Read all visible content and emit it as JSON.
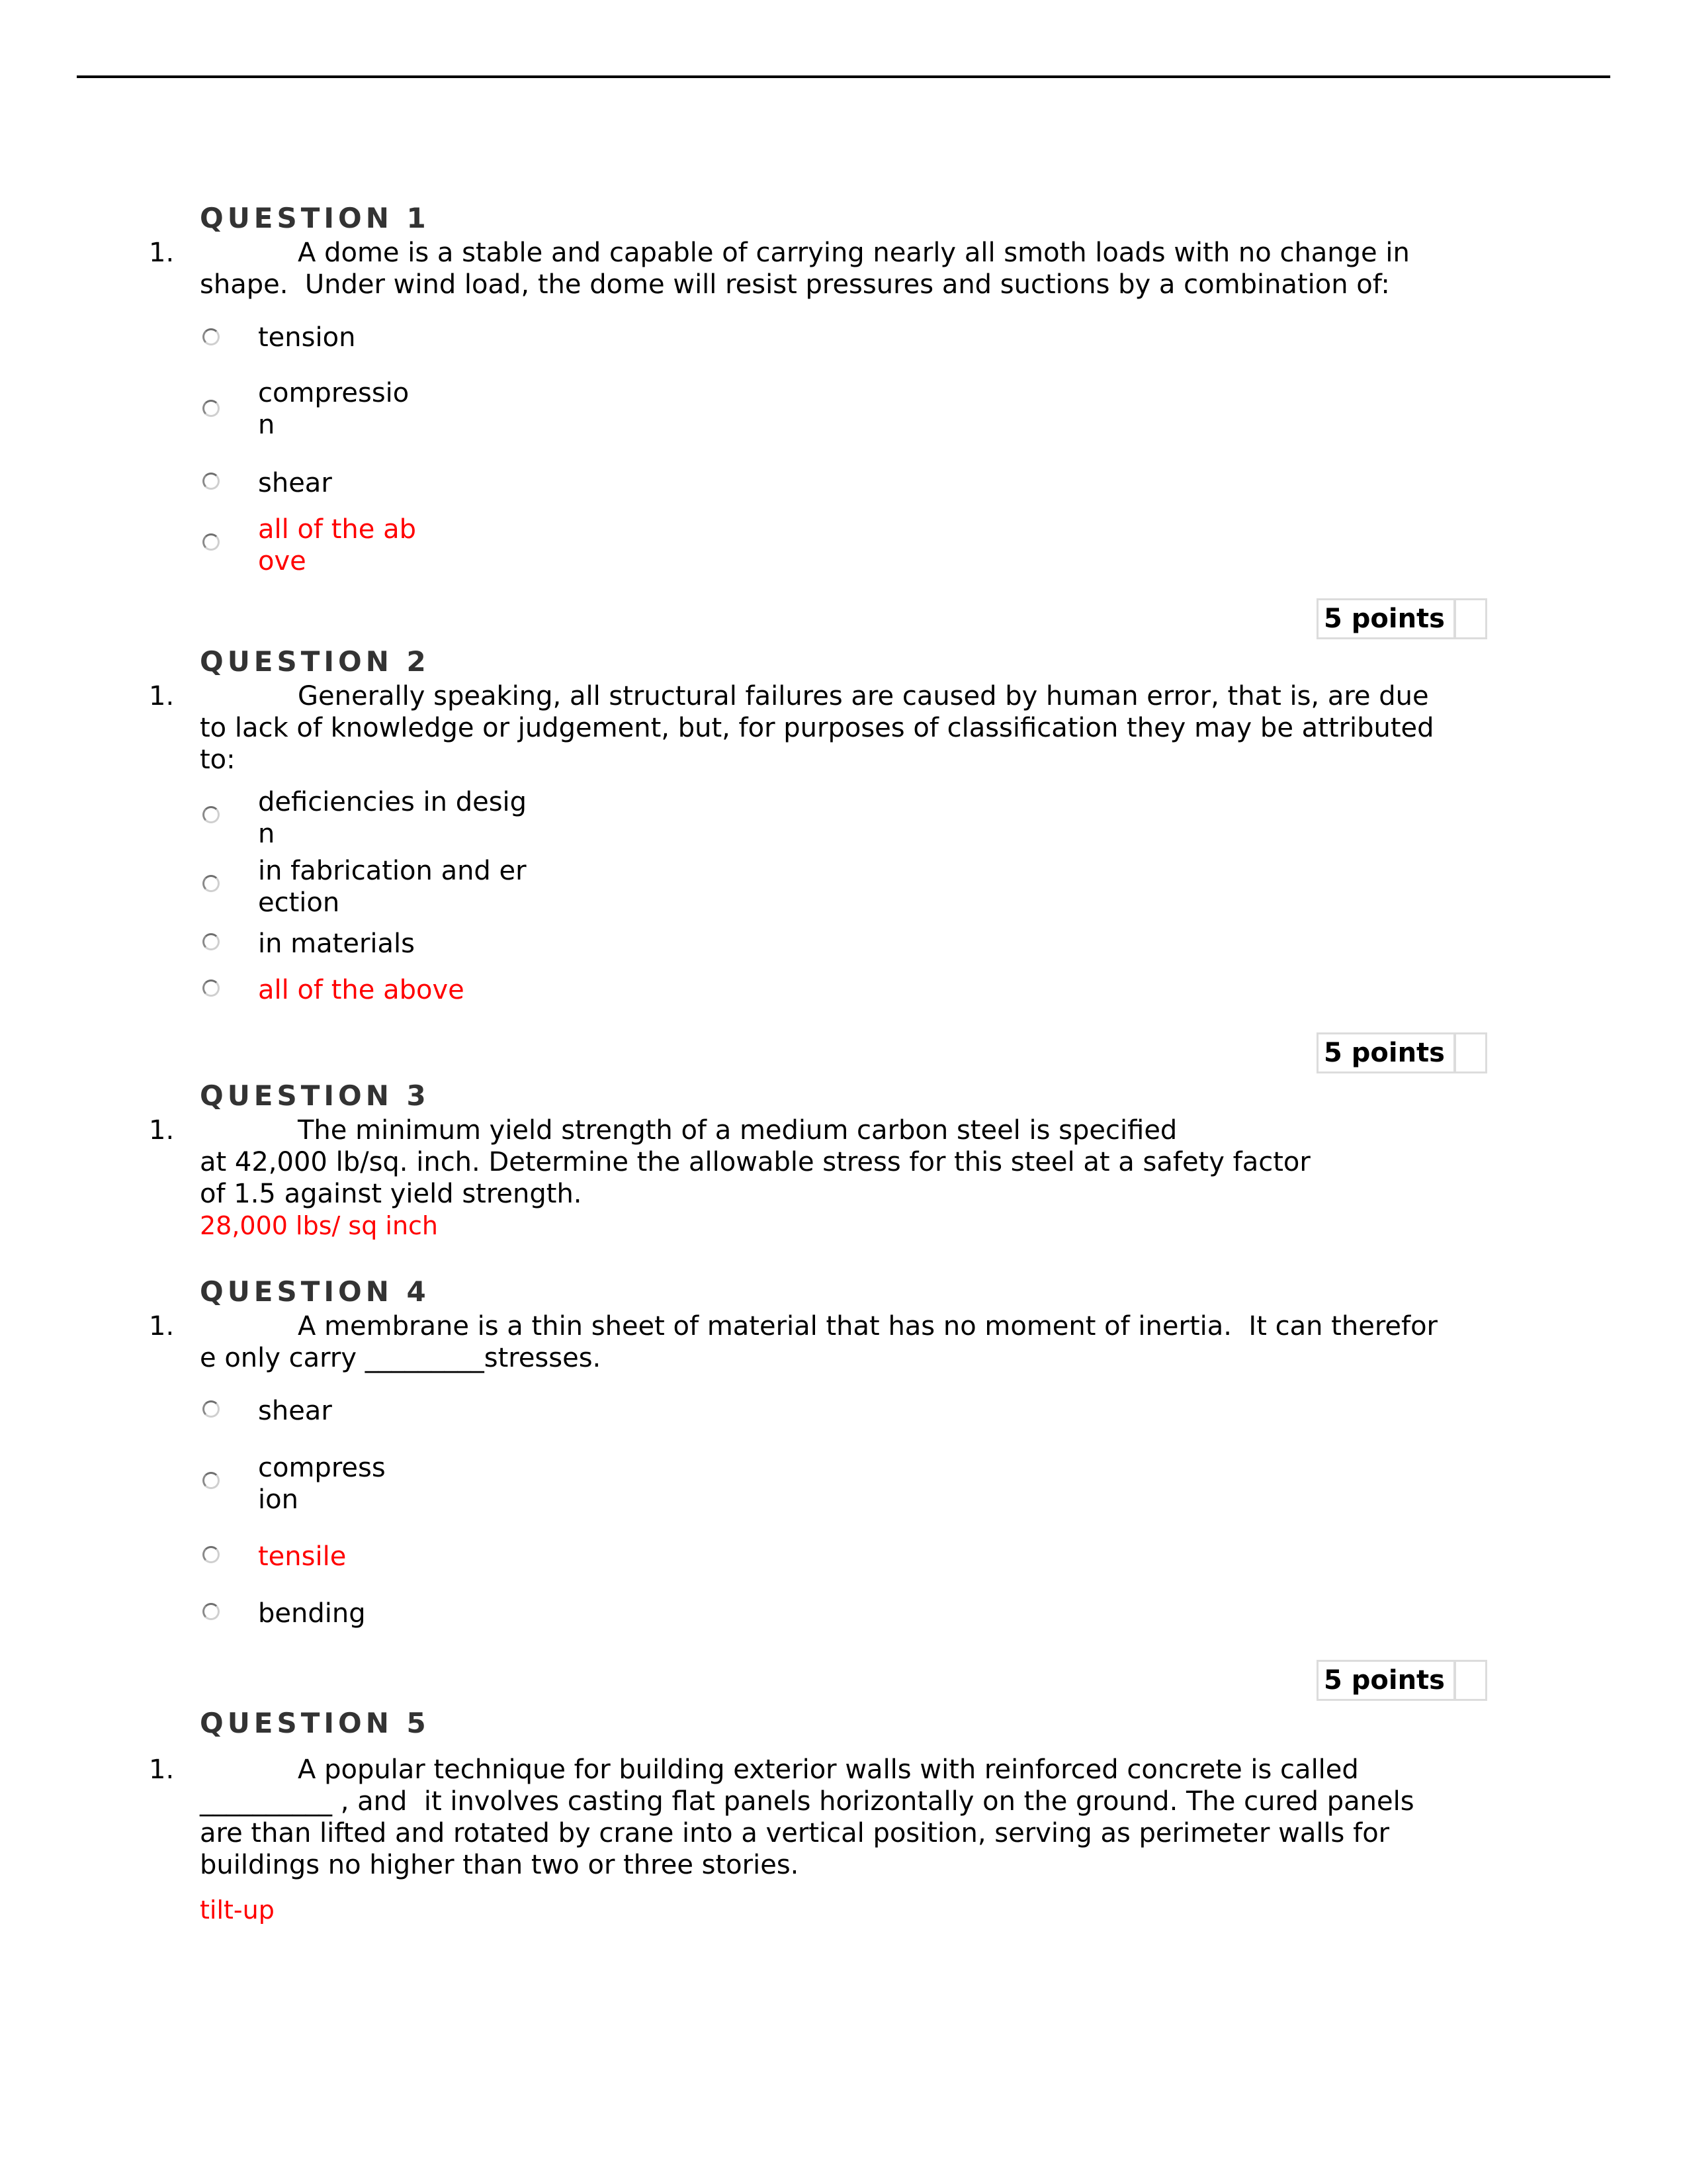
{
  "questions": [
    {
      "heading": "QUESTION 1",
      "number": "1.",
      "text_lines": [
        "A dome is a stable and capable of carrying nearly all smoth loads with no change in",
        "shape.  Under wind load, the dome will resist pressures and suctions by a combination of:"
      ],
      "options": [
        {
          "lines": [
            "tension"
          ],
          "correct": false
        },
        {
          "lines": [
            "compressio",
            "n"
          ],
          "correct": false
        },
        {
          "lines": [
            "shear"
          ],
          "correct": false
        },
        {
          "lines": [
            "all of the ab",
            "ove"
          ],
          "correct": true
        }
      ],
      "points": "5 points"
    },
    {
      "heading": "QUESTION 2",
      "number": "1.",
      "text_lines": [
        "Generally speaking, all structural failures are caused by human error, that is, are due",
        "to lack of knowledge or judgement, but, for purposes of classification they may be attributed",
        "to:"
      ],
      "options": [
        {
          "lines": [
            "deficiencies in desig",
            "n"
          ],
          "correct": false
        },
        {
          "lines": [
            "in fabrication and er",
            "ection"
          ],
          "correct": false
        },
        {
          "lines": [
            "in materials"
          ],
          "correct": false
        },
        {
          "lines": [
            "all of the above"
          ],
          "correct": true
        }
      ],
      "points": "5 points"
    },
    {
      "heading": "QUESTION 3",
      "number": "1.",
      "text_lines": [
        "The minimum yield strength of a medium carbon steel is specified",
        "at 42,000 lb/sq. inch. Determine the allowable stress for this steel at a safety factor",
        "of 1.5 against yield strength."
      ],
      "answer": "28,000 lbs/ sq inch"
    },
    {
      "heading": "QUESTION 4",
      "number": "1.",
      "text_lines": [
        "A membrane is a thin sheet of material that has no moment of inertia.  It can therefor",
        "e only carry _________stresses."
      ],
      "options": [
        {
          "lines": [
            "shear"
          ],
          "correct": false
        },
        {
          "lines": [
            "compress",
            "ion"
          ],
          "correct": false
        },
        {
          "lines": [
            "tensile"
          ],
          "correct": true
        },
        {
          "lines": [
            "bending"
          ],
          "correct": false
        }
      ],
      "points": "5 points"
    },
    {
      "heading": "QUESTION 5",
      "number": "1.",
      "text_lines": [
        "A popular technique for building exterior walls with reinforced concrete is called",
        "__________ , and  it involves casting flat panels horizontally on the ground. The cured panels",
        "are than lifted and rotated by crane into a vertical position, serving as perimeter walls for",
        "buildings no higher than two or three stories."
      ],
      "answer": "tilt-up"
    }
  ],
  "colors": {
    "correct": "#ff0000",
    "heading": "#333333"
  }
}
